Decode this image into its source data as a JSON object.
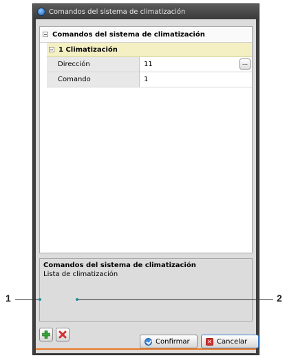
{
  "window": {
    "title": "Comandos del sistema de climatización",
    "app_icon": "app-logo-icon"
  },
  "tree": {
    "root_label": "Comandos del sistema de climatización",
    "group_label": "1 Climatización",
    "properties": [
      {
        "name": "Dirección",
        "value": "11",
        "has_button": true,
        "button_label": "..."
      },
      {
        "name": "Comando",
        "value": "1",
        "has_button": false
      }
    ]
  },
  "description": {
    "title": "Comandos del sistema de climatización",
    "text": "Lista de climatización"
  },
  "toolbar": {
    "add_icon": "plus-icon",
    "remove_icon": "x-icon"
  },
  "buttons": {
    "confirm_label": "Confirmar",
    "cancel_label": "Cancelar"
  },
  "callouts": {
    "left_number": "1",
    "right_number": "2"
  },
  "colors": {
    "accent_line": "#e87722",
    "add_green": "#3aa53a",
    "remove_red": "#d43030",
    "group_bg": "#f5f0c4"
  }
}
